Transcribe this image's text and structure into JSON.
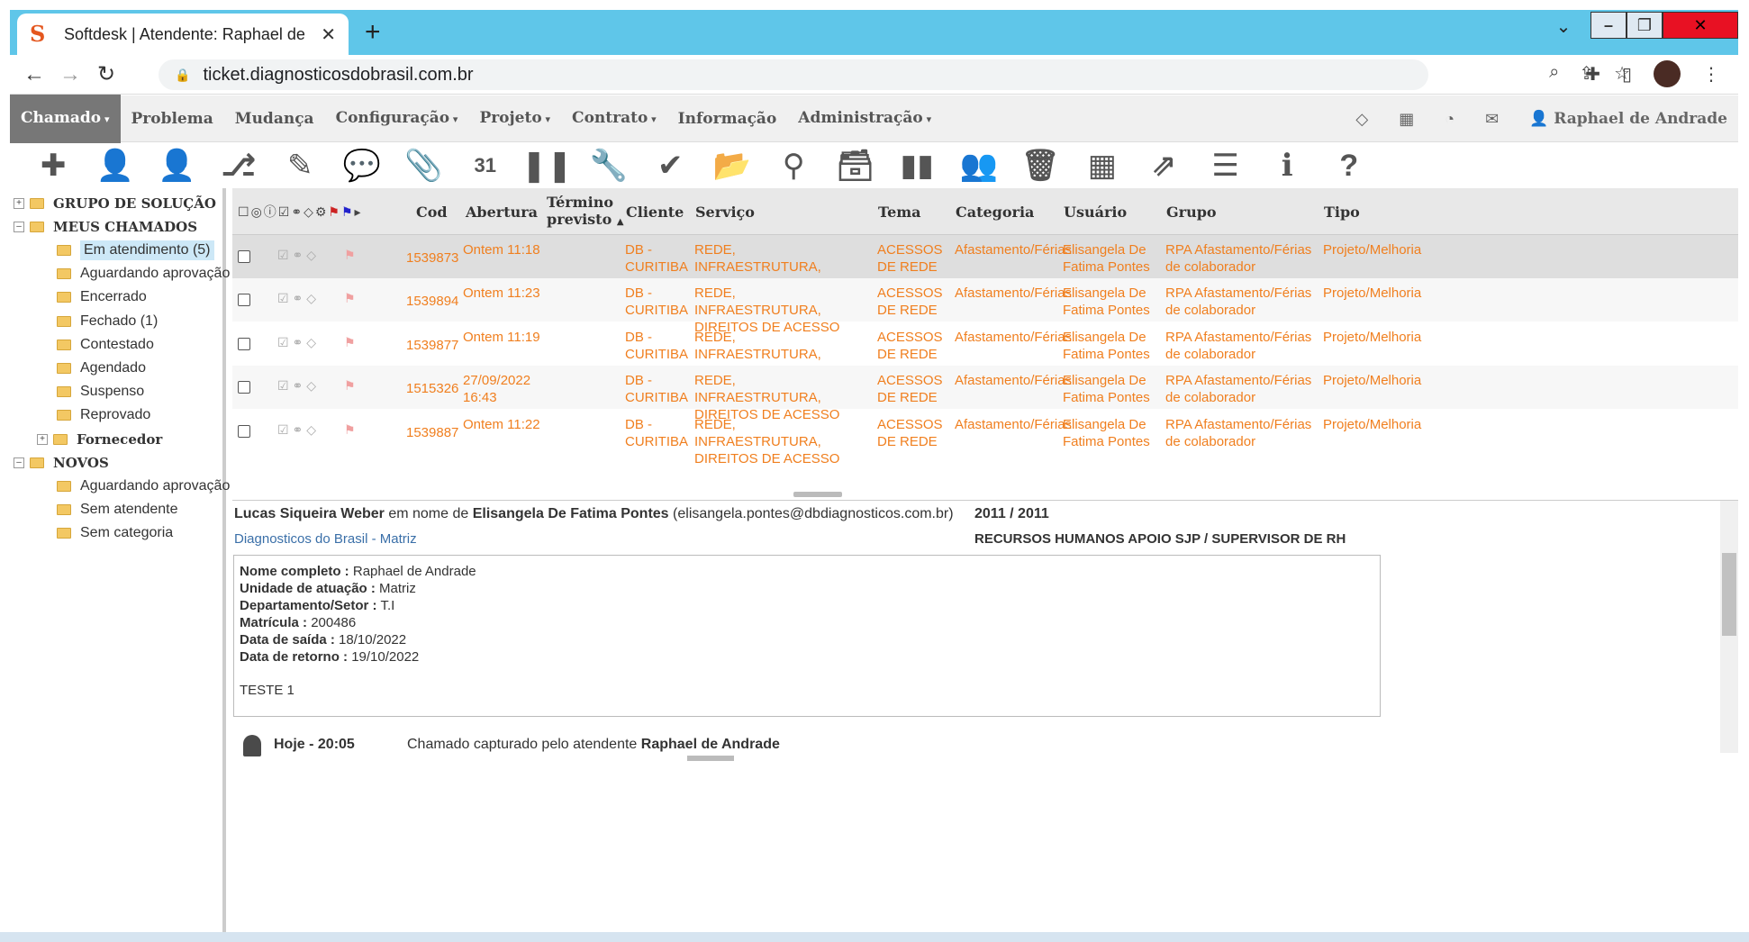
{
  "browser": {
    "tab_title": "Softdesk | Atendente: Raphael de",
    "favicon_letter": "S",
    "url": "ticket.diagnosticosdobrasil.com.br"
  },
  "menu": {
    "items": [
      "Chamado",
      "Problema",
      "Mudança",
      "Configuração",
      "Projeto",
      "Contrato",
      "Informação",
      "Administração"
    ],
    "dropdown_flags": [
      true,
      false,
      false,
      true,
      true,
      true,
      false,
      true
    ],
    "user": "Raphael de Andrade"
  },
  "toolbar": {
    "icons": [
      "plus-icon",
      "assign-user-icon",
      "add-user-icon",
      "hierarchy-icon",
      "edit-icon",
      "comment-icon",
      "attach-icon",
      "calendar-icon",
      "pause-icon",
      "wrench-icon",
      "check-icon",
      "folder-open-icon",
      "search-icon",
      "archive-icon",
      "chart-icon",
      "users-icon",
      "trash-icon",
      "schedule-icon",
      "share-icon",
      "list-icon",
      "info-icon",
      "help-icon"
    ],
    "calendar_day": "31"
  },
  "sidebar": {
    "groups": [
      {
        "label": "GRUPO DE SOLUÇÃO",
        "expanded": false
      },
      {
        "label": "MEUS CHAMADOS",
        "expanded": true
      }
    ],
    "meus": [
      "Em atendimento (5)",
      "Aguardando aprovação",
      "Encerrado",
      "Fechado (1)",
      "Contestado",
      "Agendado",
      "Suspenso",
      "Reprovado"
    ],
    "fornecedor": "Fornecedor",
    "novos": "NOVOS",
    "novos_items": [
      "Aguardando aprovação",
      "Sem atendente",
      "Sem categoria"
    ]
  },
  "grid": {
    "headers": {
      "cod": "Cod",
      "abertura": "Abertura",
      "termino_1": "Término",
      "termino_2": "previsto",
      "cliente": "Cliente",
      "servico": "Serviço",
      "tema": "Tema",
      "categoria": "Categoria",
      "usuario": "Usuário",
      "grupo": "Grupo",
      "tipo": "Tipo"
    },
    "rows": [
      {
        "cod": "1539873",
        "abertura": "Ontem 11:18",
        "cliente": "DB - CURITIBA",
        "servico": "REDE, INFRAESTRUTURA, DIREITOS DE ACESSO",
        "tema": "ACESSOS DE REDE",
        "categoria": "Afastamento/Férias",
        "usuario": "Elisangela De Fatima Pontes",
        "grupo": "RPA Afastamento/Férias de colaborador",
        "tipo": "Projeto/Melhoria"
      },
      {
        "cod": "1539894",
        "abertura": "Ontem 11:23",
        "cliente": "DB - CURITIBA",
        "servico": "REDE, INFRAESTRUTURA, DIREITOS DE ACESSO",
        "tema": "ACESSOS DE REDE",
        "categoria": "Afastamento/Férias",
        "usuario": "Elisangela De Fatima Pontes",
        "grupo": "RPA Afastamento/Férias de colaborador",
        "tipo": "Projeto/Melhoria"
      },
      {
        "cod": "1539877",
        "abertura": "Ontem 11:19",
        "cliente": "DB - CURITIBA",
        "servico": "REDE, INFRAESTRUTURA, DIREITOS DE ACESSO",
        "tema": "ACESSOS DE REDE",
        "categoria": "Afastamento/Férias",
        "usuario": "Elisangela De Fatima Pontes",
        "grupo": "RPA Afastamento/Férias de colaborador",
        "tipo": "Projeto/Melhoria"
      },
      {
        "cod": "1515326",
        "abertura": "27/09/2022 16:43",
        "cliente": "DB - CURITIBA",
        "servico": "REDE, INFRAESTRUTURA, DIREITOS DE ACESSO",
        "tema": "ACESSOS DE REDE",
        "categoria": "Afastamento/Férias",
        "usuario": "Elisangela De Fatima Pontes",
        "grupo": "RPA Afastamento/Férias de colaborador",
        "tipo": "Projeto/Melhoria"
      },
      {
        "cod": "1539887",
        "abertura": "Ontem 11:22",
        "cliente": "DB - CURITIBA",
        "servico": "REDE, INFRAESTRUTURA, DIREITOS DE ACESSO",
        "tema": "ACESSOS DE REDE",
        "categoria": "Afastamento/Férias",
        "usuario": "Elisangela De Fatima Pontes",
        "grupo": "RPA Afastamento/Férias de colaborador",
        "tipo": "Projeto/Melhoria"
      }
    ]
  },
  "detail": {
    "requester": "Lucas Siqueira Weber",
    "em_nome_de": "em nome de",
    "beneficiary": "Elisangela De Fatima Pontes",
    "email": "(elisangela.pontes@dbdiagnosticos.com.br)",
    "org": "Diagnosticos do Brasil - Matriz",
    "number": "2011 / 2011",
    "dept": "RECURSOS HUMANOS APOIO SJP / SUPERVISOR DE RH",
    "fields": [
      {
        "k": "Nome completo :",
        "v": "Raphael de Andrade"
      },
      {
        "k": "Unidade de atuação :",
        "v": "Matriz"
      },
      {
        "k": "Departamento/Setor :",
        "v": "T.I"
      },
      {
        "k": "Matrícula :",
        "v": "200486"
      },
      {
        "k": "Data de saída :",
        "v": "18/10/2022"
      },
      {
        "k": "Data de retorno :",
        "v": "19/10/2022"
      }
    ],
    "note": "TESTE 1",
    "history_time": "Hoje - 20:05",
    "history_text": "Chamado capturado pelo atendente",
    "history_user": "Raphael de Andrade"
  }
}
